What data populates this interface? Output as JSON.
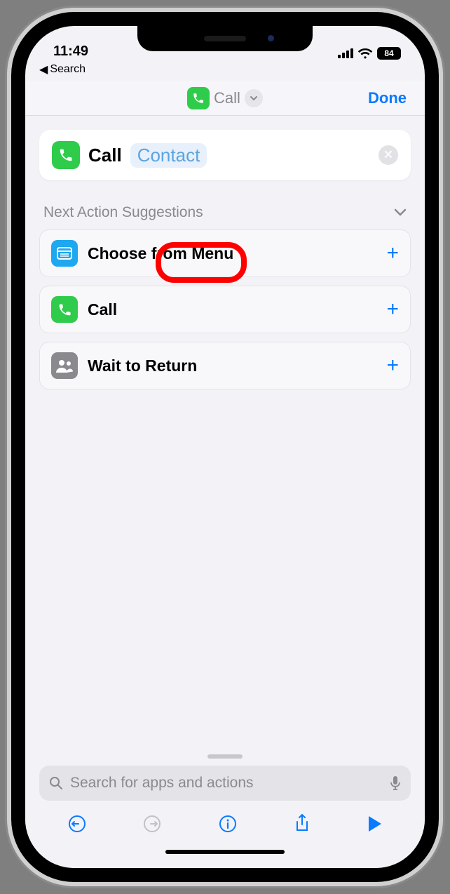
{
  "status": {
    "time": "11:49",
    "battery": "84"
  },
  "breadcrumb": {
    "label": "Search"
  },
  "nav": {
    "title": "Call",
    "done": "Done"
  },
  "action": {
    "verb": "Call",
    "param": "Contact"
  },
  "suggestions": {
    "header": "Next Action Suggestions",
    "items": [
      {
        "label": "Choose from Menu",
        "icon": "menu"
      },
      {
        "label": "Call",
        "icon": "phone"
      },
      {
        "label": "Wait to Return",
        "icon": "people"
      }
    ]
  },
  "search": {
    "placeholder": "Search for apps and actions"
  }
}
